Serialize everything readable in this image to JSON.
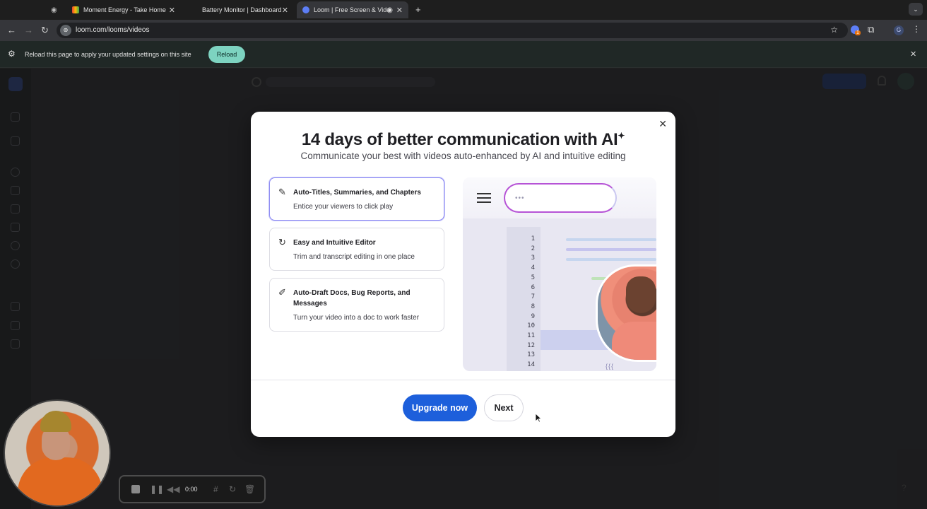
{
  "browser": {
    "tabs": [
      {
        "label": "",
        "active": false,
        "icon": "media-icon"
      },
      {
        "label": "Moment Energy - Take Home",
        "active": false,
        "icon": "gmail-icon"
      },
      {
        "label": "Battery Monitor | Dashboard",
        "active": false,
        "icon": "page-icon"
      },
      {
        "label": "Loom | Free Screen & Vide",
        "active": true,
        "icon": "loom-icon"
      }
    ],
    "url": "loom.com/looms/videos",
    "extension_badge": "1",
    "profile_initial": "G"
  },
  "infobar": {
    "message": "Reload this page to apply your updated settings on this site",
    "reload_label": "Reload"
  },
  "modal": {
    "title": "14 days of better communication with AI",
    "sparkle": "✦",
    "subtitle": "Communicate your best with videos auto-enhanced by AI and intuitive editing",
    "features": [
      {
        "title": "Auto-Titles, Summaries, and Chapters",
        "description": "Entice your viewers to click play",
        "icon": "magic-wand-icon",
        "selected": true
      },
      {
        "title": "Easy and Intuitive Editor",
        "description": "Trim and transcript editing in one place",
        "icon": "refresh-sparkle-icon",
        "selected": false
      },
      {
        "title": "Auto-Draft Docs, Bug Reports, and Messages",
        "description": "Turn your video into a doc to work faster",
        "icon": "pen-sparkle-icon",
        "selected": false
      }
    ],
    "illustration": {
      "line_numbers": [
        "1",
        "2",
        "3",
        "4",
        "5",
        "6",
        "7",
        "8",
        "9",
        "10",
        "11",
        "12",
        "13",
        "14"
      ],
      "braces": "{{{",
      "pill_dots": "•••"
    },
    "upgrade_label": "Upgrade now",
    "next_label": "Next"
  },
  "recorder": {
    "timer": "0:00"
  },
  "colors": {
    "primary_button": "#1d5fdb",
    "reload_button": "#7dd3c0",
    "selected_border": "#8f8df2"
  }
}
